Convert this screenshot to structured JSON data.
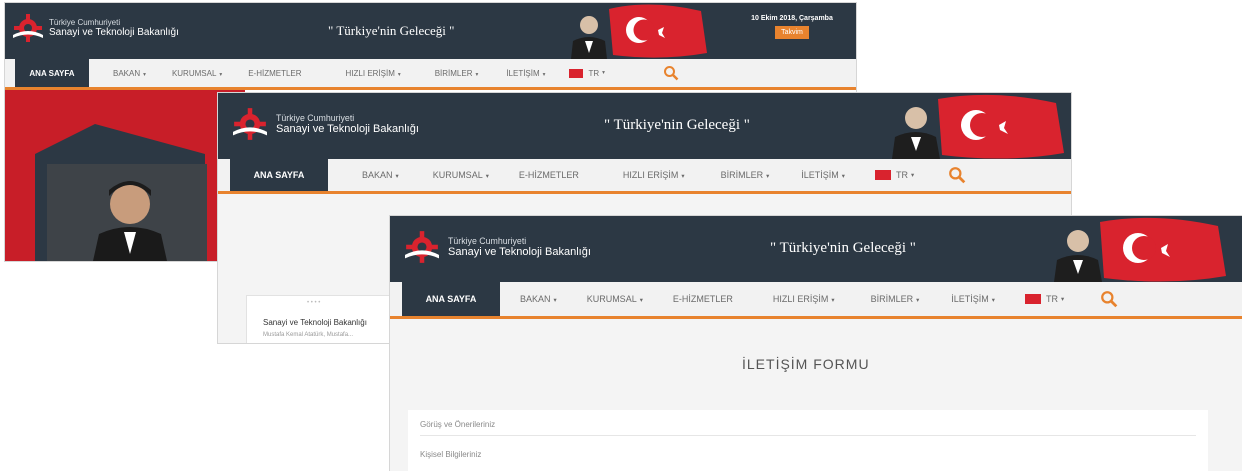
{
  "site": {
    "logo_line1": "Türkiye Cumhuriyeti",
    "logo_line2": "Sanayi ve Teknoloji Bakanlığı",
    "slogan": "\" Türkiye'nin Geleceği \""
  },
  "nav": {
    "home": "ANA SAYFA",
    "items": [
      "BAKAN",
      "KURUMSAL",
      "E-HİZMETLER",
      "HIZLI ERİŞİM",
      "BİRİMLER",
      "İLETİŞİM"
    ],
    "lang": "TR"
  },
  "window1": {
    "date": "10 Ekim 2018, Çarşamba",
    "date_button": "Takvim"
  },
  "window2": {
    "news_title": "Sanayi ve Teknoloji Bakanlığı",
    "news_sub": "Mustafa Kemal Atatürk, Mustafa..."
  },
  "window3": {
    "form_title": "İLETİŞİM FORMU",
    "rows": [
      "Görüş ve Önerileriniz",
      "Kişisel Bilgileriniz"
    ]
  },
  "colors": {
    "header": "#2c3844",
    "accent": "#e8832e",
    "flag_red": "#d9232e"
  }
}
